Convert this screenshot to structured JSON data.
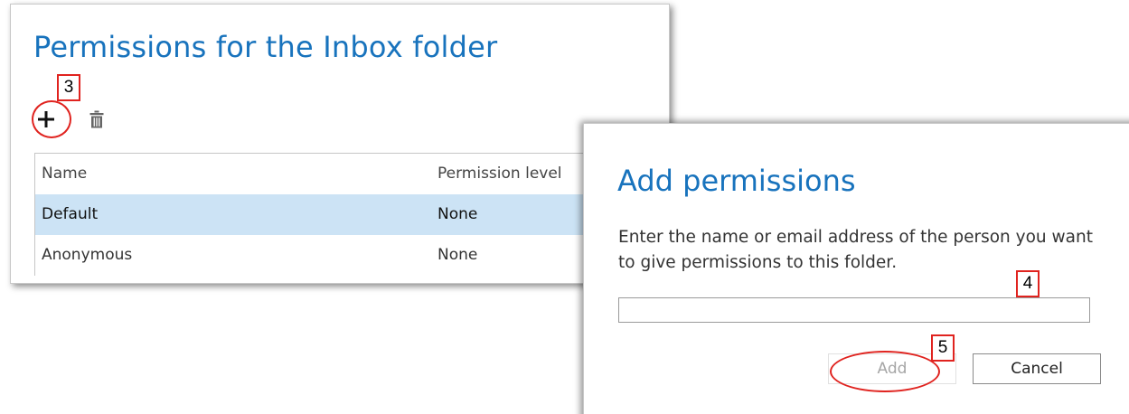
{
  "permissions_panel": {
    "title": "Permissions for the Inbox folder",
    "toolbar": {
      "add_icon": "plus-icon",
      "delete_icon": "trash-icon"
    },
    "table": {
      "columns": [
        "Name",
        "Permission level"
      ],
      "rows": [
        {
          "name": "Default",
          "level": "None",
          "selected": true
        },
        {
          "name": "Anonymous",
          "level": "None",
          "selected": false
        }
      ]
    }
  },
  "add_dialog": {
    "title": "Add permissions",
    "description": "Enter the name or email address of the person you want to give permissions to this folder.",
    "input": {
      "value": "",
      "placeholder": ""
    },
    "add_label": "Add",
    "cancel_label": "Cancel"
  },
  "callouts": {
    "step_3": "3",
    "step_4": "4",
    "step_5": "5"
  },
  "colors": {
    "title_blue": "#1873bd",
    "selected_row": "#cce3f5",
    "callout_red": "#e0231f"
  }
}
